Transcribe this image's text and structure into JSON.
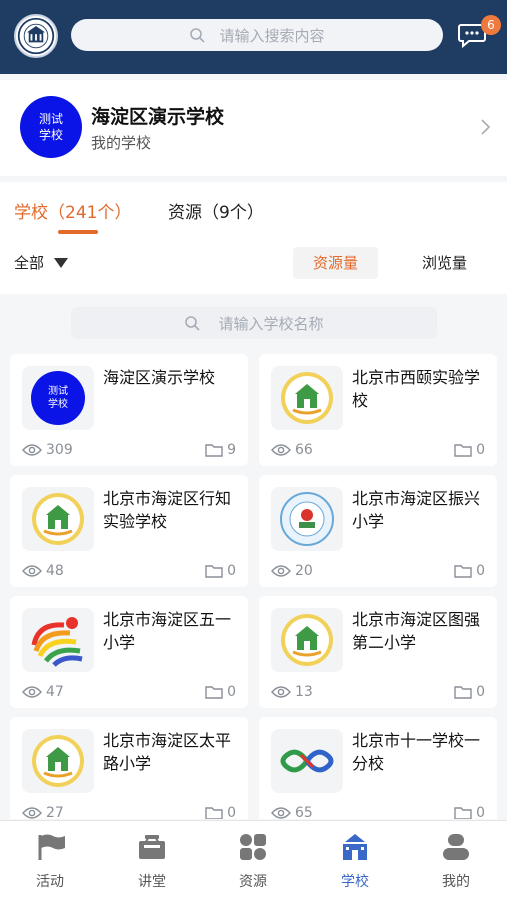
{
  "header": {
    "logo_icon": "school-emblem-icon",
    "search_placeholder": "请输入搜索内容",
    "message_icon": "chat-bubble-icon",
    "message_badge": "6"
  },
  "my_school": {
    "avatar_text": "测试\n学校",
    "name": "海淀区演示学校",
    "subtitle": "我的学校"
  },
  "tabs": [
    {
      "label": "学校（241个）",
      "active": true
    },
    {
      "label": "资源（9个）",
      "active": false
    }
  ],
  "filters": {
    "scope_label": "全部",
    "sort_options": [
      {
        "label": "资源量",
        "active": true
      },
      {
        "label": "浏览量",
        "active": false
      }
    ]
  },
  "school_search_placeholder": "请输入学校名称",
  "schools": [
    {
      "name": "海淀区演示学校",
      "views": "309",
      "resources": "9",
      "logo": "blue-badge"
    },
    {
      "name": "北京市西颐实验学校",
      "views": "66",
      "resources": "0",
      "logo": "green-house"
    },
    {
      "name": "北京市海淀区行知实验学校",
      "views": "48",
      "resources": "0",
      "logo": "green-house"
    },
    {
      "name": "北京市海淀区振兴小学",
      "views": "20",
      "resources": "0",
      "logo": "seal-round"
    },
    {
      "name": "北京市海淀区五一小学",
      "views": "47",
      "resources": "0",
      "logo": "rainbow-swirl"
    },
    {
      "name": "北京市海淀区图强第二小学",
      "views": "13",
      "resources": "0",
      "logo": "green-house"
    },
    {
      "name": "北京市海淀区太平路小学",
      "views": "27",
      "resources": "0",
      "logo": "green-house"
    },
    {
      "name": "北京市十一学校一分校",
      "views": "65",
      "resources": "0",
      "logo": "infinity-loop"
    }
  ],
  "bottom_nav": [
    {
      "label": "活动",
      "icon": "flag-icon",
      "active": false
    },
    {
      "label": "讲堂",
      "icon": "lecture-icon",
      "active": false
    },
    {
      "label": "资源",
      "icon": "grid-icon",
      "active": false
    },
    {
      "label": "学校",
      "icon": "school-building-icon",
      "active": true
    },
    {
      "label": "我的",
      "icon": "person-icon",
      "active": false
    }
  ],
  "colors": {
    "header_bg": "#1f3c63",
    "accent": "#e26a2c",
    "nav_active": "#3a68c9",
    "badge": "#f07a3e"
  }
}
